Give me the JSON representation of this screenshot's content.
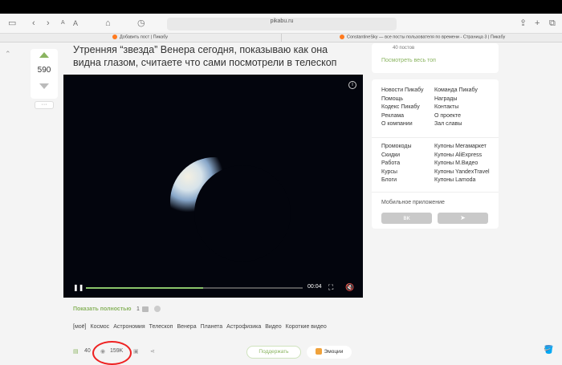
{
  "browser": {
    "url": "pikabu.ru",
    "tabs": [
      {
        "title": "Добавить пост | Пикабу"
      },
      {
        "title": "ConstantineSky — все посты пользователя по времени - Страница 3 | Пикабу"
      }
    ],
    "text_size_small": "A",
    "text_size_large": "A"
  },
  "post": {
    "vote_count": "590",
    "more_button": "···",
    "title": "Утренняя “звезда” Венера сегодня, показываю как она видна глазом, считаете что сами посмотрели в телескоп",
    "video": {
      "time": "00:04",
      "progress": 0.54
    },
    "show_full_label": "Показать полностью",
    "show_full_count": "1",
    "tags": [
      "[моё]",
      "Космос",
      "Астрономия",
      "Телескоп",
      "Венера",
      "Планета",
      "Астрофизика",
      "Видео",
      "Короткие видео"
    ],
    "comments_count": "40",
    "views": "159K",
    "support_label": "Поддержать",
    "emotions_label": "Эмоции"
  },
  "sidebar": {
    "posts_count": "40 постов",
    "see_top": "Посмотреть весь топ",
    "links_left": [
      "Новости Пикабу",
      "Помощь",
      "Кодекс Пикабу",
      "Реклама",
      "О компании"
    ],
    "links_right": [
      "Команда Пикабу",
      "Награды",
      "Контакты",
      "О проекте",
      "Зал славы"
    ],
    "promo_left": [
      "Промокоды",
      "Скидки",
      "Работа",
      "Курсы",
      "Блоги"
    ],
    "promo_right": [
      "Купоны Мегамаркет",
      "Купоны AliExpress",
      "Купоны М.Видео",
      "Купоны YandexTravel",
      "Купоны Lamoda"
    ],
    "mobile_label": "Мобильное приложение"
  }
}
